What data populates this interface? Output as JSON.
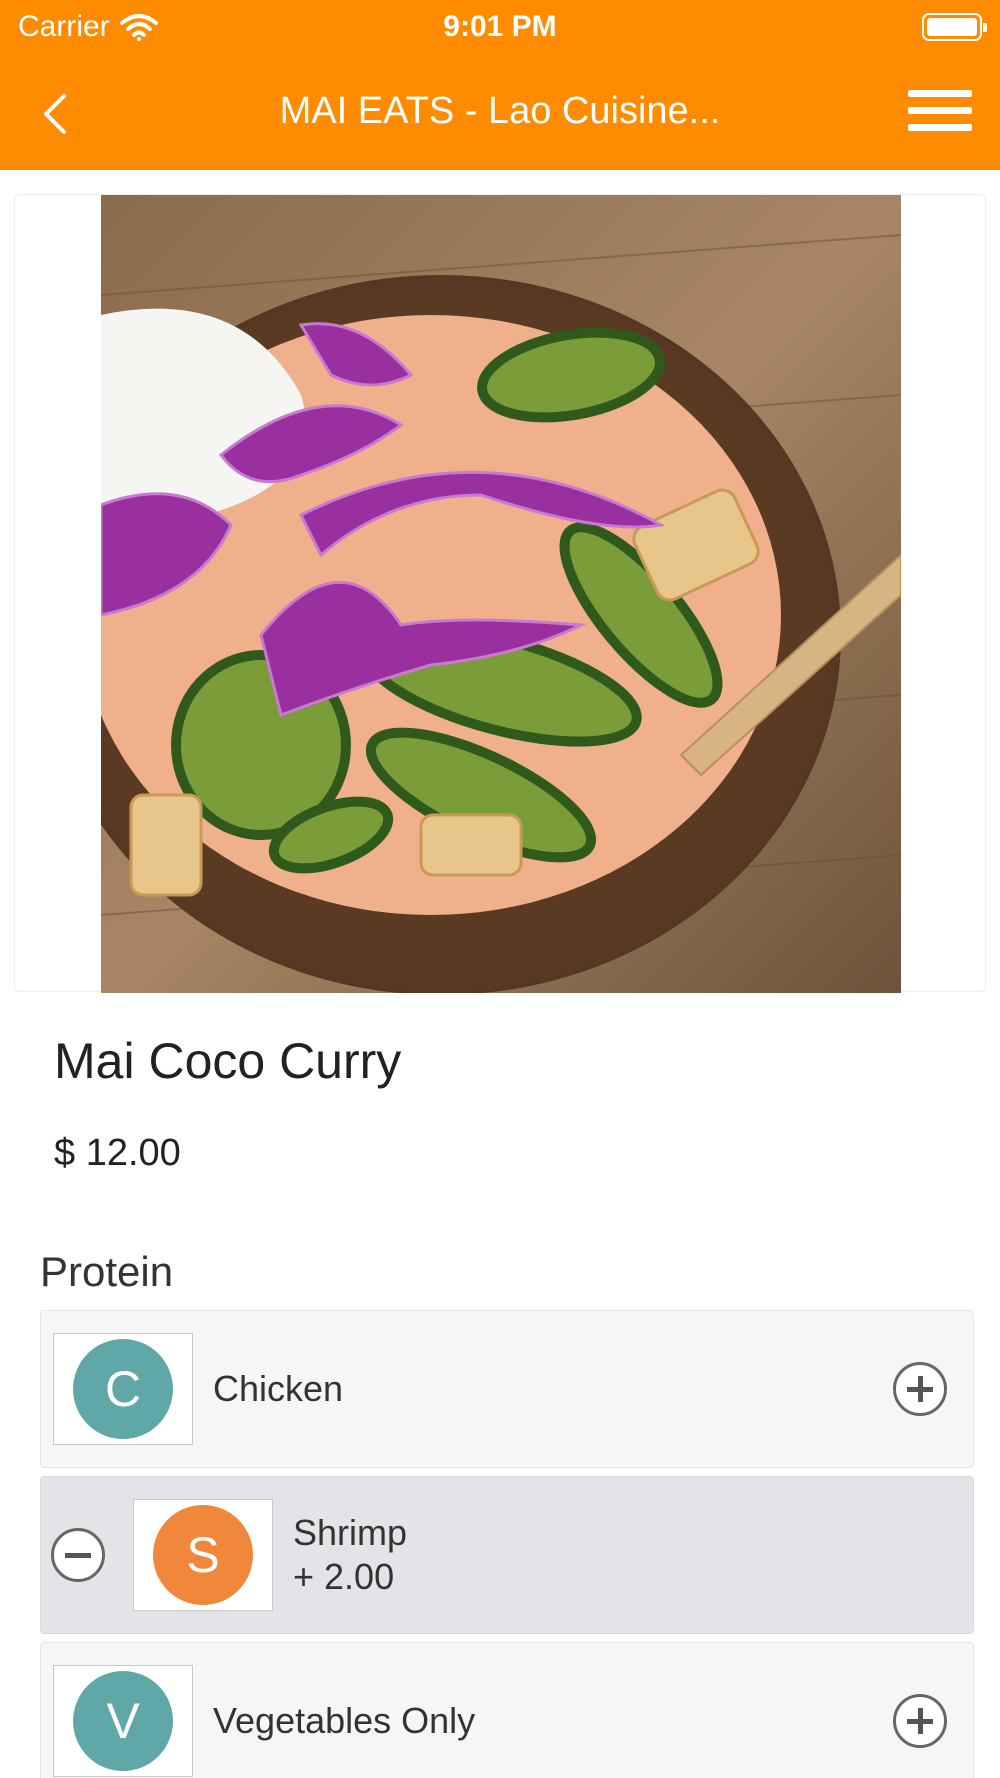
{
  "status_bar": {
    "carrier": "Carrier",
    "time": "9:01 PM"
  },
  "nav": {
    "title": "MAI EATS - Lao Cuisine...",
    "back_icon": "chevron-left-icon",
    "menu_icon": "hamburger-menu-icon"
  },
  "product": {
    "name": "Mai Coco Curry",
    "price": "$ 12.00"
  },
  "protein": {
    "title": "Protein",
    "options": [
      {
        "initial": "C",
        "label": "Chicken",
        "extra": "",
        "selected": false,
        "color": "#5fa8a7"
      },
      {
        "initial": "S",
        "label": "Shrimp",
        "extra": "+ 2.00",
        "selected": true,
        "color": "#f0873a"
      },
      {
        "initial": "V",
        "label": "Vegetables Only",
        "extra": "",
        "selected": false,
        "color": "#5fa8a7"
      }
    ]
  },
  "colors": {
    "accent": "#ff8c00"
  }
}
